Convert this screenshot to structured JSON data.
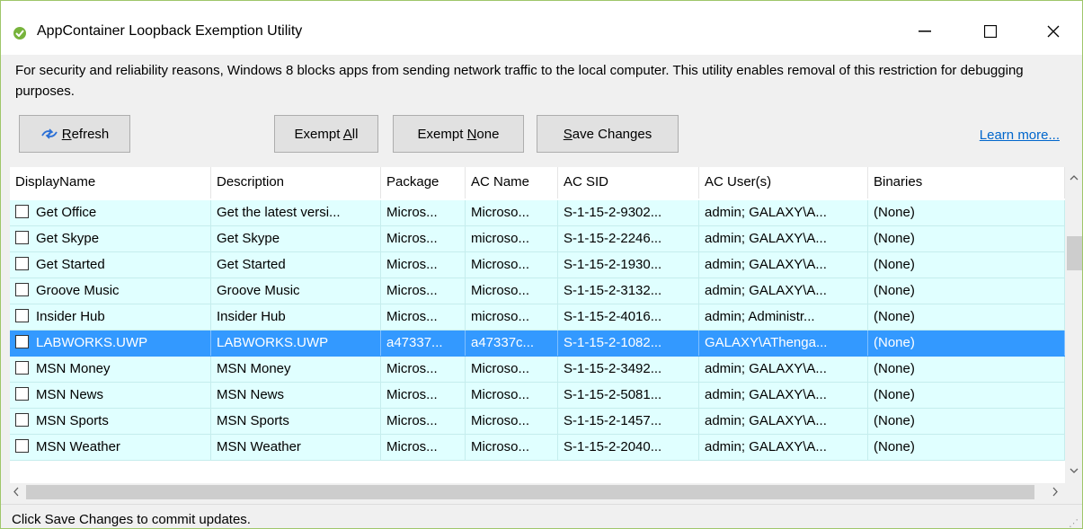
{
  "window": {
    "title": "AppContainer Loopback Exemption Utility",
    "minimize_symbol": "—",
    "maximize_symbol": "☐",
    "close_symbol": "✕"
  },
  "info_text": "For security and reliability reasons, Windows 8 blocks apps from sending network traffic to the local computer. This utility enables removal of this restriction for debugging purposes.",
  "toolbar": {
    "refresh": {
      "pre": "",
      "key": "R",
      "post": "efresh"
    },
    "exempt_all": {
      "pre": "Exempt ",
      "key": "A",
      "post": "ll"
    },
    "exempt_none": {
      "pre": "Exempt ",
      "key": "N",
      "post": "one"
    },
    "save_changes": {
      "pre": "",
      "key": "S",
      "post": "ave Changes"
    },
    "learn_more": "Learn more..."
  },
  "grid": {
    "columns": [
      "DisplayName",
      "Description",
      "Package",
      "AC Name",
      "AC SID",
      "AC User(s)",
      "Binaries"
    ],
    "rows": [
      [
        "Get Office",
        "Get the latest versi...",
        "Micros...",
        "Microso...",
        "S-1-15-2-9302...",
        "admin; GALAXY\\A...",
        "(None)"
      ],
      [
        "Get Skype",
        "Get Skype",
        "Micros...",
        "microso...",
        "S-1-15-2-2246...",
        "admin; GALAXY\\A...",
        "(None)"
      ],
      [
        "Get Started",
        "Get Started",
        "Micros...",
        "Microso...",
        "S-1-15-2-1930...",
        "admin; GALAXY\\A...",
        "(None)"
      ],
      [
        "Groove Music",
        "Groove Music",
        "Micros...",
        "Microso...",
        "S-1-15-2-3132...",
        "admin; GALAXY\\A...",
        "(None)"
      ],
      [
        "Insider Hub",
        "Insider Hub",
        "Micros...",
        "microso...",
        "S-1-15-2-4016...",
        "admin; Administr...",
        "(None)"
      ],
      [
        "LABWORKS.UWP",
        "LABWORKS.UWP",
        "a47337...",
        "a47337c...",
        "S-1-15-2-1082...",
        "GALAXY\\AThenga...",
        "(None)"
      ],
      [
        "MSN Money",
        "MSN Money",
        "Micros...",
        "Microso...",
        "S-1-15-2-3492...",
        "admin; GALAXY\\A...",
        "(None)"
      ],
      [
        "MSN News",
        "MSN News",
        "Micros...",
        "Microso...",
        "S-1-15-2-5081...",
        "admin; GALAXY\\A...",
        "(None)"
      ],
      [
        "MSN Sports",
        "MSN Sports",
        "Micros...",
        "Microso...",
        "S-1-15-2-1457...",
        "admin; GALAXY\\A...",
        "(None)"
      ],
      [
        "MSN Weather",
        "MSN Weather",
        "Micros...",
        "Microso...",
        "S-1-15-2-2040...",
        "admin; GALAXY\\A...",
        "(None)"
      ]
    ],
    "selected_row": 5
  },
  "status_text": "Click Save Changes to commit updates.",
  "colors": {
    "accent_green": "#77b33b",
    "row_background": "#e0ffff",
    "selection": "#3399ff",
    "link": "#0066cc"
  },
  "icons": {
    "app": "app-check-icon",
    "refresh": "refresh-arrows-icon",
    "scroll_up": "chevron-up-icon",
    "scroll_down": "chevron-down-icon",
    "scroll_left": "chevron-left-icon",
    "scroll_right": "chevron-right-icon"
  }
}
